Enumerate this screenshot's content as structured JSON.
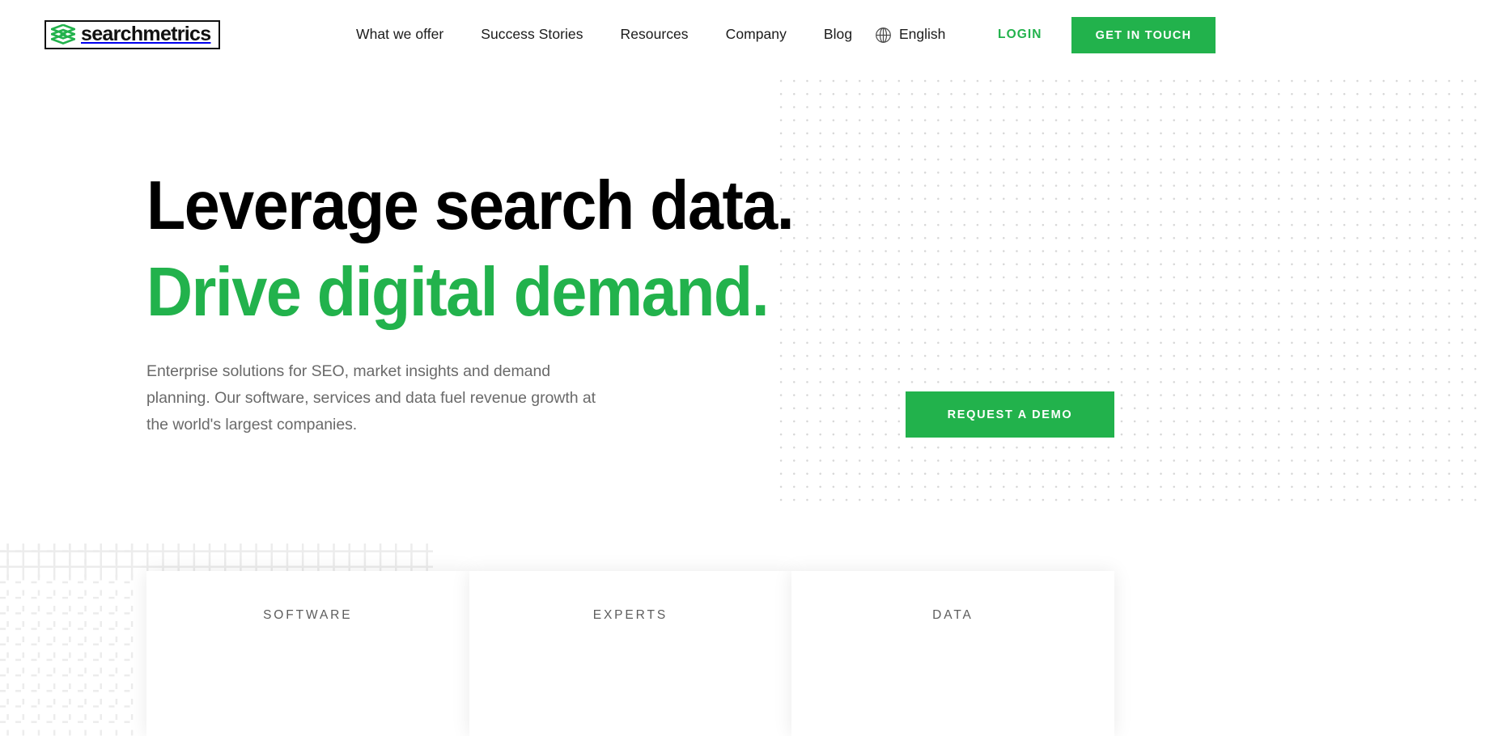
{
  "brand": {
    "name": "searchmetrics",
    "logo_icon": "layered-chevron-icon",
    "accent_color": "#22b24c",
    "text_color": "#111111"
  },
  "header": {
    "nav_items": [
      {
        "label": "What we offer"
      },
      {
        "label": "Success Stories"
      },
      {
        "label": "Resources"
      },
      {
        "label": "Company"
      },
      {
        "label": "Blog"
      }
    ],
    "language": {
      "icon": "globe-icon",
      "label": "English"
    },
    "login_label": "LOGIN",
    "cta_label": "GET IN TOUCH"
  },
  "hero": {
    "title_line_1": "Leverage search data.",
    "title_line_2": "Drive digital demand.",
    "title_line_1_color": "#000000",
    "title_line_2_color": "#22b24c",
    "subtitle": "Enterprise solutions for SEO, market insights and demand planning. Our software, services and data fuel revenue growth at the world's largest companies.",
    "cta_label": "REQUEST A DEMO",
    "background_pattern": "dot-grid"
  },
  "cards": [
    {
      "label": "SOFTWARE"
    },
    {
      "label": "EXPERTS"
    },
    {
      "label": "DATA"
    }
  ],
  "decor": {
    "bottom_left_pattern": "plus-grid"
  }
}
